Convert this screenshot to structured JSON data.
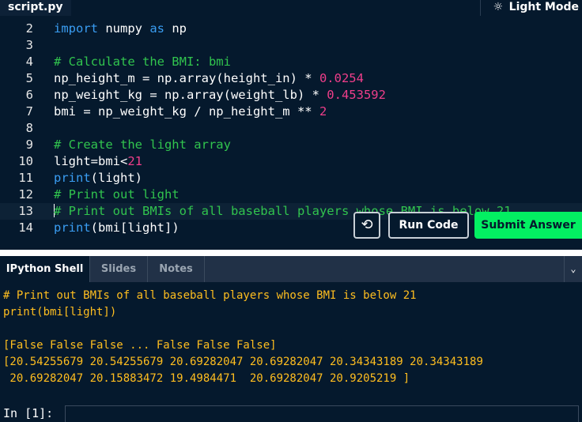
{
  "header": {
    "file_tab": "script.py",
    "theme_toggle": "Light Mode"
  },
  "editor": {
    "lines": [
      {
        "n": "2",
        "parts": [
          {
            "t": "import",
            "c": "kw"
          },
          {
            "t": " numpy "
          },
          {
            "t": "as",
            "c": "kw"
          },
          {
            "t": " np"
          }
        ]
      },
      {
        "n": "3",
        "parts": []
      },
      {
        "n": "4",
        "parts": [
          {
            "t": "# Calculate the BMI: bmi",
            "c": "cm"
          }
        ]
      },
      {
        "n": "5",
        "parts": [
          {
            "t": "np_height_m = np.array(height_in) * "
          },
          {
            "t": "0.0254",
            "c": "num"
          }
        ]
      },
      {
        "n": "6",
        "parts": [
          {
            "t": "np_weight_kg = np.array(weight_lb) * "
          },
          {
            "t": "0.453592",
            "c": "num"
          }
        ]
      },
      {
        "n": "7",
        "parts": [
          {
            "t": "bmi = np_weight_kg / np_height_m ** "
          },
          {
            "t": "2",
            "c": "num"
          }
        ]
      },
      {
        "n": "8",
        "parts": []
      },
      {
        "n": "9",
        "parts": [
          {
            "t": "# Create the light array",
            "c": "cm"
          }
        ]
      },
      {
        "n": "10",
        "parts": [
          {
            "t": "light=bmi<"
          },
          {
            "t": "21",
            "c": "num"
          }
        ]
      },
      {
        "n": "11",
        "parts": [
          {
            "t": "print",
            "c": "kw"
          },
          {
            "t": "(light)"
          }
        ]
      },
      {
        "n": "12",
        "parts": [
          {
            "t": "# Print out light",
            "c": "cm"
          }
        ]
      },
      {
        "n": "13",
        "parts": [
          {
            "t": "# Print out BMIs of all baseball players whose BMI is below 21",
            "c": "cm"
          }
        ],
        "current": true
      },
      {
        "n": "14",
        "parts": [
          {
            "t": "print",
            "c": "kw"
          },
          {
            "t": "(bmi[light])"
          }
        ]
      }
    ]
  },
  "buttons": {
    "reset_icon": "reset-icon",
    "run_label": "Run Code",
    "submit_label": "Submit Answer"
  },
  "shell": {
    "tabs": [
      {
        "label": "IPython Shell",
        "active": true
      },
      {
        "label": "Slides",
        "active": false
      },
      {
        "label": "Notes",
        "active": false
      }
    ],
    "output": [
      "# Print out BMIs of all baseball players whose BMI is below 21",
      "print(bmi[light])",
      "",
      "[False False False ... False False False]",
      "[20.54255679 20.54255679 20.69282047 20.69282047 20.34343189 20.34343189",
      " 20.69282047 20.15883472 19.4984471  20.69282047 20.9205219 ]"
    ],
    "prompt": "In [1]:",
    "input_value": ""
  },
  "colors": {
    "background": "#05192d",
    "keyword": "#3a9df2",
    "comment": "#31c44e",
    "number": "#ef3e8a",
    "output": "#ffbe1f",
    "submit": "#03ef62"
  }
}
